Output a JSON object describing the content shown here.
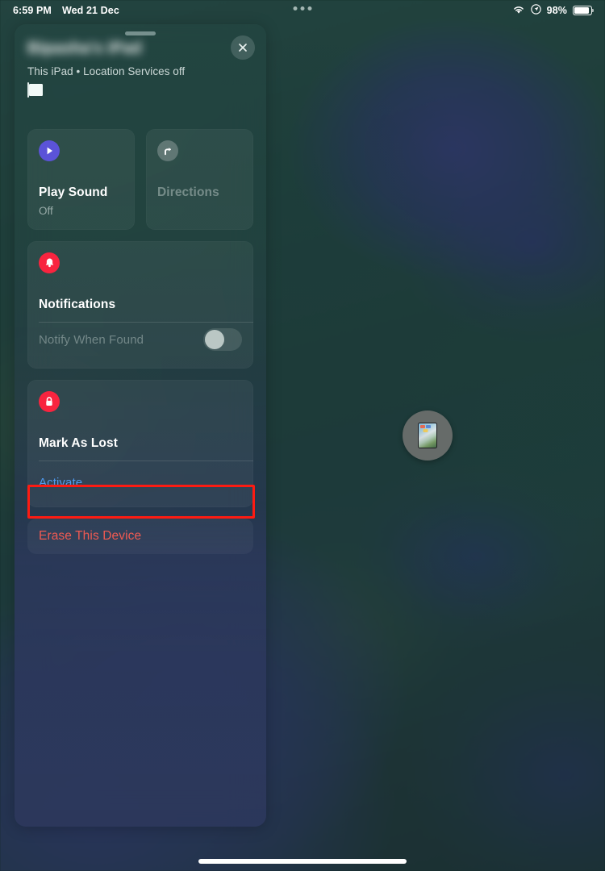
{
  "status_bar": {
    "time": "6:59 PM",
    "date": "Wed 21 Dec",
    "wifi_icon": "wifi-icon",
    "location_icon": "location-services-icon",
    "battery_percent": "98%",
    "battery_icon": "battery-icon",
    "multitask_icon": "multitasking-dots-icon"
  },
  "panel": {
    "grabber": "sheet-grabber",
    "device_name": "Bipasha's iPad",
    "device_subtitle": "This iPad • Location Services off",
    "device_battery_icon": "battery-icon",
    "close_icon": "close-icon",
    "cards": {
      "play_sound": {
        "icon": "play-icon",
        "icon_color": "#5b53d8",
        "title": "Play Sound",
        "subtitle": "Off"
      },
      "directions": {
        "icon": "directions-arrow-icon",
        "icon_color": "#a8b0b0",
        "title": "Directions",
        "disabled": true
      },
      "notifications": {
        "icon": "bell-icon",
        "icon_color": "#f8243f",
        "title": "Notifications",
        "row_label": "Notify When Found",
        "toggle_state": "off"
      },
      "mark_as_lost": {
        "icon": "lock-icon",
        "icon_color": "#f8243f",
        "title": "Mark As Lost",
        "action_label": "Activate",
        "action_color": "#4f9bf0"
      },
      "erase": {
        "label": "Erase This Device",
        "color": "#f05a52"
      }
    }
  },
  "annotation": {
    "name": "erase-this-device-highlight",
    "color": "#fd1b12"
  },
  "map": {
    "marker_icon": "device-marker-icon"
  },
  "home_indicator": "home-indicator"
}
